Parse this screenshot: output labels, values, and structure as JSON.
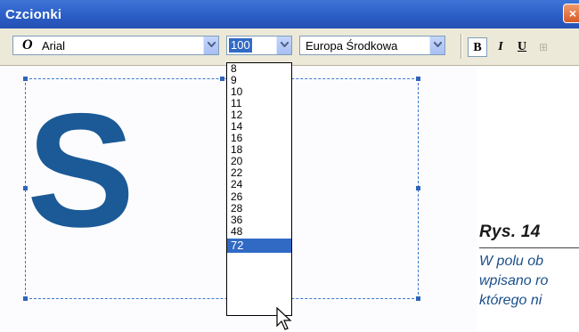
{
  "window": {
    "title": "Czcionki",
    "close_glyph": "×"
  },
  "toolbar": {
    "font_icon": "O",
    "font_name": "Arial",
    "font_size": "100",
    "charset": "Europa Środkowa",
    "bold_label": "B",
    "italic_label": "I",
    "underline_label": "U",
    "extra_label": "⊞"
  },
  "canvas": {
    "preview_letter": "S"
  },
  "size_dropdown": {
    "options": [
      "8",
      "9",
      "10",
      "11",
      "12",
      "14",
      "16",
      "18",
      "20",
      "22",
      "24",
      "26",
      "28",
      "36",
      "48",
      "72"
    ],
    "selected": "72"
  },
  "caption": {
    "title": "Rys. 14",
    "lines": [
      "W polu ob",
      "wpisano ro",
      "którego ni"
    ]
  }
}
